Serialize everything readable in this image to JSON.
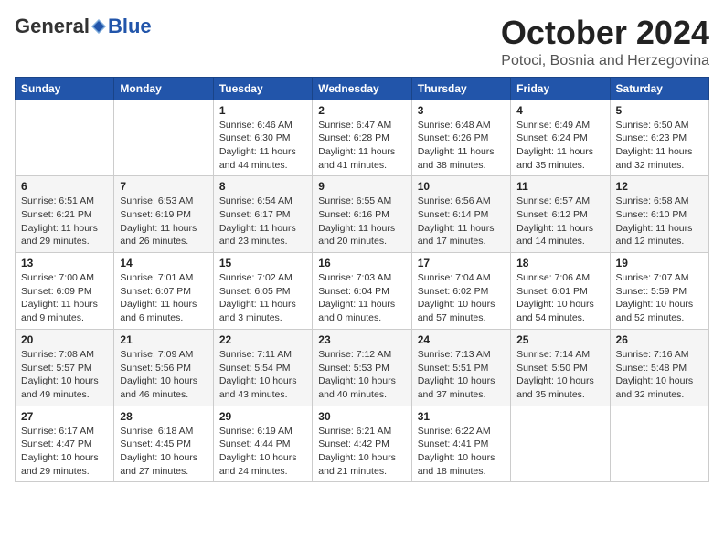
{
  "header": {
    "logo_general": "General",
    "logo_blue": "Blue",
    "month_title": "October 2024",
    "location": "Potoci, Bosnia and Herzegovina"
  },
  "days_of_week": [
    "Sunday",
    "Monday",
    "Tuesday",
    "Wednesday",
    "Thursday",
    "Friday",
    "Saturday"
  ],
  "weeks": [
    [
      {
        "day": "",
        "info": ""
      },
      {
        "day": "",
        "info": ""
      },
      {
        "day": "1",
        "info": "Sunrise: 6:46 AM\nSunset: 6:30 PM\nDaylight: 11 hours and 44 minutes."
      },
      {
        "day": "2",
        "info": "Sunrise: 6:47 AM\nSunset: 6:28 PM\nDaylight: 11 hours and 41 minutes."
      },
      {
        "day": "3",
        "info": "Sunrise: 6:48 AM\nSunset: 6:26 PM\nDaylight: 11 hours and 38 minutes."
      },
      {
        "day": "4",
        "info": "Sunrise: 6:49 AM\nSunset: 6:24 PM\nDaylight: 11 hours and 35 minutes."
      },
      {
        "day": "5",
        "info": "Sunrise: 6:50 AM\nSunset: 6:23 PM\nDaylight: 11 hours and 32 minutes."
      }
    ],
    [
      {
        "day": "6",
        "info": "Sunrise: 6:51 AM\nSunset: 6:21 PM\nDaylight: 11 hours and 29 minutes."
      },
      {
        "day": "7",
        "info": "Sunrise: 6:53 AM\nSunset: 6:19 PM\nDaylight: 11 hours and 26 minutes."
      },
      {
        "day": "8",
        "info": "Sunrise: 6:54 AM\nSunset: 6:17 PM\nDaylight: 11 hours and 23 minutes."
      },
      {
        "day": "9",
        "info": "Sunrise: 6:55 AM\nSunset: 6:16 PM\nDaylight: 11 hours and 20 minutes."
      },
      {
        "day": "10",
        "info": "Sunrise: 6:56 AM\nSunset: 6:14 PM\nDaylight: 11 hours and 17 minutes."
      },
      {
        "day": "11",
        "info": "Sunrise: 6:57 AM\nSunset: 6:12 PM\nDaylight: 11 hours and 14 minutes."
      },
      {
        "day": "12",
        "info": "Sunrise: 6:58 AM\nSunset: 6:10 PM\nDaylight: 11 hours and 12 minutes."
      }
    ],
    [
      {
        "day": "13",
        "info": "Sunrise: 7:00 AM\nSunset: 6:09 PM\nDaylight: 11 hours and 9 minutes."
      },
      {
        "day": "14",
        "info": "Sunrise: 7:01 AM\nSunset: 6:07 PM\nDaylight: 11 hours and 6 minutes."
      },
      {
        "day": "15",
        "info": "Sunrise: 7:02 AM\nSunset: 6:05 PM\nDaylight: 11 hours and 3 minutes."
      },
      {
        "day": "16",
        "info": "Sunrise: 7:03 AM\nSunset: 6:04 PM\nDaylight: 11 hours and 0 minutes."
      },
      {
        "day": "17",
        "info": "Sunrise: 7:04 AM\nSunset: 6:02 PM\nDaylight: 10 hours and 57 minutes."
      },
      {
        "day": "18",
        "info": "Sunrise: 7:06 AM\nSunset: 6:01 PM\nDaylight: 10 hours and 54 minutes."
      },
      {
        "day": "19",
        "info": "Sunrise: 7:07 AM\nSunset: 5:59 PM\nDaylight: 10 hours and 52 minutes."
      }
    ],
    [
      {
        "day": "20",
        "info": "Sunrise: 7:08 AM\nSunset: 5:57 PM\nDaylight: 10 hours and 49 minutes."
      },
      {
        "day": "21",
        "info": "Sunrise: 7:09 AM\nSunset: 5:56 PM\nDaylight: 10 hours and 46 minutes."
      },
      {
        "day": "22",
        "info": "Sunrise: 7:11 AM\nSunset: 5:54 PM\nDaylight: 10 hours and 43 minutes."
      },
      {
        "day": "23",
        "info": "Sunrise: 7:12 AM\nSunset: 5:53 PM\nDaylight: 10 hours and 40 minutes."
      },
      {
        "day": "24",
        "info": "Sunrise: 7:13 AM\nSunset: 5:51 PM\nDaylight: 10 hours and 37 minutes."
      },
      {
        "day": "25",
        "info": "Sunrise: 7:14 AM\nSunset: 5:50 PM\nDaylight: 10 hours and 35 minutes."
      },
      {
        "day": "26",
        "info": "Sunrise: 7:16 AM\nSunset: 5:48 PM\nDaylight: 10 hours and 32 minutes."
      }
    ],
    [
      {
        "day": "27",
        "info": "Sunrise: 6:17 AM\nSunset: 4:47 PM\nDaylight: 10 hours and 29 minutes."
      },
      {
        "day": "28",
        "info": "Sunrise: 6:18 AM\nSunset: 4:45 PM\nDaylight: 10 hours and 27 minutes."
      },
      {
        "day": "29",
        "info": "Sunrise: 6:19 AM\nSunset: 4:44 PM\nDaylight: 10 hours and 24 minutes."
      },
      {
        "day": "30",
        "info": "Sunrise: 6:21 AM\nSunset: 4:42 PM\nDaylight: 10 hours and 21 minutes."
      },
      {
        "day": "31",
        "info": "Sunrise: 6:22 AM\nSunset: 4:41 PM\nDaylight: 10 hours and 18 minutes."
      },
      {
        "day": "",
        "info": ""
      },
      {
        "day": "",
        "info": ""
      }
    ]
  ]
}
